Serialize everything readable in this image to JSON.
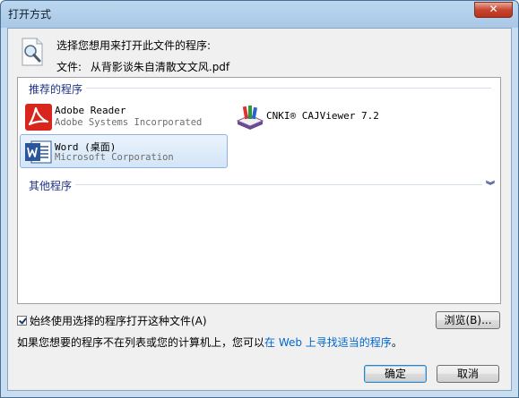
{
  "window": {
    "title": "打开方式",
    "close_label": "✕"
  },
  "header": {
    "prompt": "选择您想用来打开此文件的程序:",
    "file_label": "文件:",
    "file_name": "从背影谈朱自清散文文风.pdf"
  },
  "recommended": {
    "label": "推荐的程序",
    "apps": [
      {
        "name": "Adobe Reader",
        "vendor": "Adobe Systems Incorporated"
      },
      {
        "name": "CNKI® CAJViewer 7.2",
        "vendor": ""
      },
      {
        "name": "Word (桌面)",
        "vendor": "Microsoft Corporation"
      }
    ]
  },
  "other": {
    "label": "其他程序"
  },
  "options": {
    "always_use": "始终使用选择的程序打开这种文件(A)"
  },
  "buttons": {
    "browse": "浏览(B)...",
    "ok": "确定",
    "cancel": "取消"
  },
  "footer": {
    "text_before": "如果您想要的程序不在列表或您的计算机上，您可以",
    "link": "在 Web 上寻找适当的程序",
    "text_after": "。"
  },
  "colors": {
    "adobe_red": "#d8261c",
    "word_blue": "#2b579a",
    "group_header": "#1e3287",
    "link": "#0066cc"
  }
}
